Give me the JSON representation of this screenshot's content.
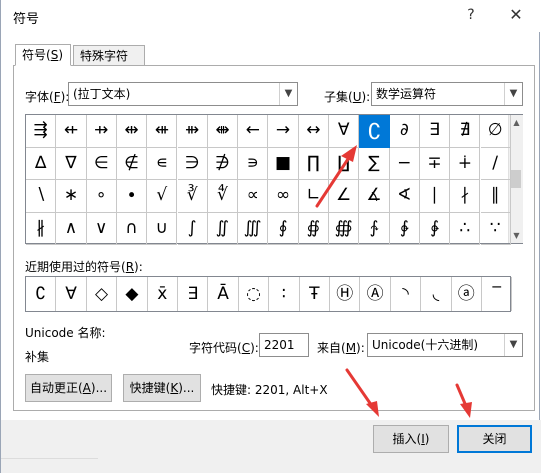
{
  "window": {
    "title": "符号",
    "help_glyph": "?",
    "close_glyph": "✕"
  },
  "tabs": [
    {
      "label": "符号(",
      "key": "S",
      "tail": ")"
    },
    {
      "label": "特殊字符(",
      "key": "P",
      "tail": ")"
    }
  ],
  "font": {
    "label": "字体(",
    "key": "F",
    "tail": "):",
    "value": "(拉丁文本)"
  },
  "subset": {
    "label": "子集(",
    "key": "U",
    "tail": "):",
    "value": "数学运算符"
  },
  "grid_rows": [
    [
      "⇶",
      "⇷",
      "⇸",
      "⇹",
      "⇺",
      "⇻",
      "⇼",
      "←",
      "→",
      "↔",
      "∀",
      "∁",
      "∂",
      "∃",
      "∄",
      "∅"
    ],
    [
      "∆",
      "∇",
      "∈",
      "∉",
      "∊",
      "∋",
      "∌",
      "∍",
      "■",
      "∏",
      "∐",
      "∑",
      "−",
      "∓",
      "∔",
      "∕"
    ],
    [
      "∖",
      "∗",
      "∘",
      "∙",
      "√",
      "∛",
      "∜",
      "∝",
      "∞",
      "∟",
      "∠",
      "∡",
      "∢",
      "∣",
      "∤",
      "∥"
    ],
    [
      "∦",
      "∧",
      "∨",
      "∩",
      "∪",
      "∫",
      "∬",
      "∭",
      "∮",
      "∯",
      "∰",
      "∱",
      "∲",
      "∳",
      "∴",
      "∵"
    ]
  ],
  "selected_symbol": "∁",
  "recent": {
    "label": "近期使用过的符号(",
    "key": "R",
    "tail": "):",
    "symbols": [
      "∁",
      "∀",
      "◇",
      "◆",
      "x̄",
      "∃",
      "Ā",
      "◌",
      "∶",
      "Ŧ",
      "Ⓗ",
      "Ⓐ",
      "◝",
      "◟",
      "ⓐ",
      "‾"
    ]
  },
  "unicode_name": {
    "label": "Unicode 名称:",
    "value": "补集"
  },
  "char_code": {
    "label": "字符代码(",
    "key": "C",
    "tail": "):",
    "value": "2201"
  },
  "from": {
    "label": "来自(",
    "key": "M",
    "tail": "):",
    "value": "Unicode(十六进制)"
  },
  "autocorrect_button": {
    "label": "自动更正(",
    "key": "A",
    "tail": ")..."
  },
  "shortcut_button": {
    "label": "快捷键(",
    "key": "K",
    "tail": ")..."
  },
  "shortcut_text": "快捷键: 2201, Alt+X",
  "insert_button": {
    "label": "插入(",
    "key": "I",
    "tail": ")"
  },
  "close_button": {
    "label": "关闭"
  },
  "colors": {
    "selection": "#0078d7",
    "annotation_arrow": "#e53935"
  }
}
